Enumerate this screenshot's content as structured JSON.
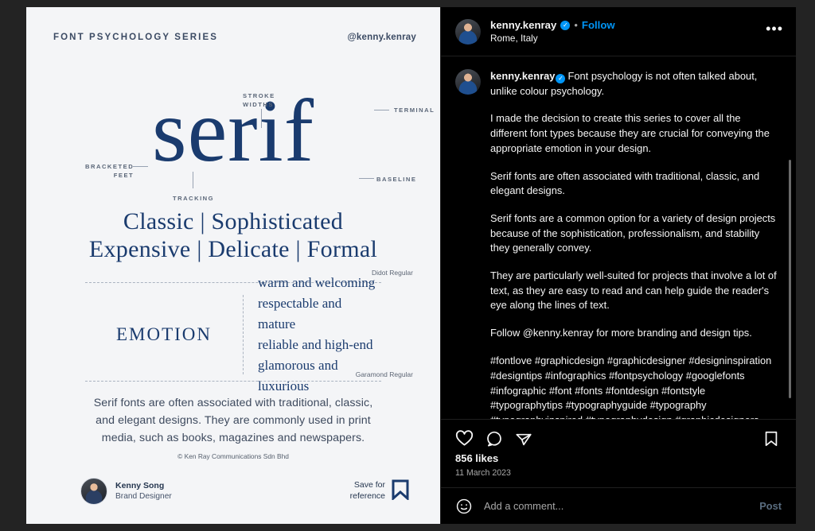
{
  "post_creative": {
    "kicker": "FONT PSYCHOLOGY SERIES",
    "handle": "@kenny.kenray",
    "hero_word": "serif",
    "callouts": {
      "stroke_widths": "STROKE\nWIDTHS",
      "terminal": "TERMINAL",
      "bracketed_feet": "BRACKETED\nFEET",
      "baseline": "BASELINE",
      "tracking": "TRACKING"
    },
    "adjectives_line1": "Classic | Sophisticated",
    "adjectives_line2": "Expensive | Delicate | Formal",
    "font_credit_1": "Didot Regular",
    "font_credit_2": "Garamond Regular",
    "emotion_label": "EMOTION",
    "emotion_items": "warm and welcoming\nrespectable and mature\nreliable and high-end\nglamorous and luxurious",
    "summary": "Serif fonts are often associated with traditional, classic, and elegant designs. They are commonly used in print media, such as books, magazines and newspapers.",
    "copyright": "© Ken Ray Communications Sdn Bhd",
    "author_name": "Kenny Song",
    "author_role": "Brand Designer",
    "save_label": "Save for\nreference",
    "accent_navy": "#1a3b6e",
    "paper": "#f4f5f7"
  },
  "side_panel": {
    "header": {
      "username": "kenny.kenray",
      "verified_glyph": "✓",
      "separator": "•",
      "follow_label": "Follow",
      "location": "Rome, Italy",
      "more_label": "•••"
    },
    "caption": {
      "username": "kenny.kenray",
      "paragraph_1": "Font psychology is not often talked about, unlike colour psychology.",
      "paragraph_2": "I made the decision to create this series to cover all the different font types because they are crucial for conveying the appropriate emotion in your design.",
      "paragraph_3": "Serif fonts are often associated with traditional, classic, and elegant designs.",
      "paragraph_4": "Serif fonts are a common option for a variety of design projects because of the sophistication, professionalism, and stability they generally convey.",
      "paragraph_5": "They are particularly well-suited for projects that involve a lot of text, as they are easy to read and can help guide the reader's eye along the lines of text.",
      "paragraph_6": "Follow @kenny.kenray for more branding and design tips.",
      "hashtags": "#fontlove #graphicdesign #graphicdesigner #designinspiration #designtips #infographics #fontpsychology #googlefonts #infographic #font #fonts #fontdesign #fontstyle #typographytips #typographyguide #typography #typographyinspired #typographydesign #graphicdesigners #typographyinspiration #typographyideas #kenray"
    },
    "actions": {
      "like_icon": "heart-icon",
      "comment_icon": "comment-bubble-icon",
      "share_icon": "share-paper-plane-icon",
      "save_icon": "bookmark-icon"
    },
    "likes_count": "856 likes",
    "post_date": "11 March 2023",
    "comment_bar": {
      "emoji_icon": "emoji-smiley-icon",
      "placeholder": "Add a comment...",
      "post_label": "Post"
    },
    "accent_blue": "#0095f6"
  }
}
